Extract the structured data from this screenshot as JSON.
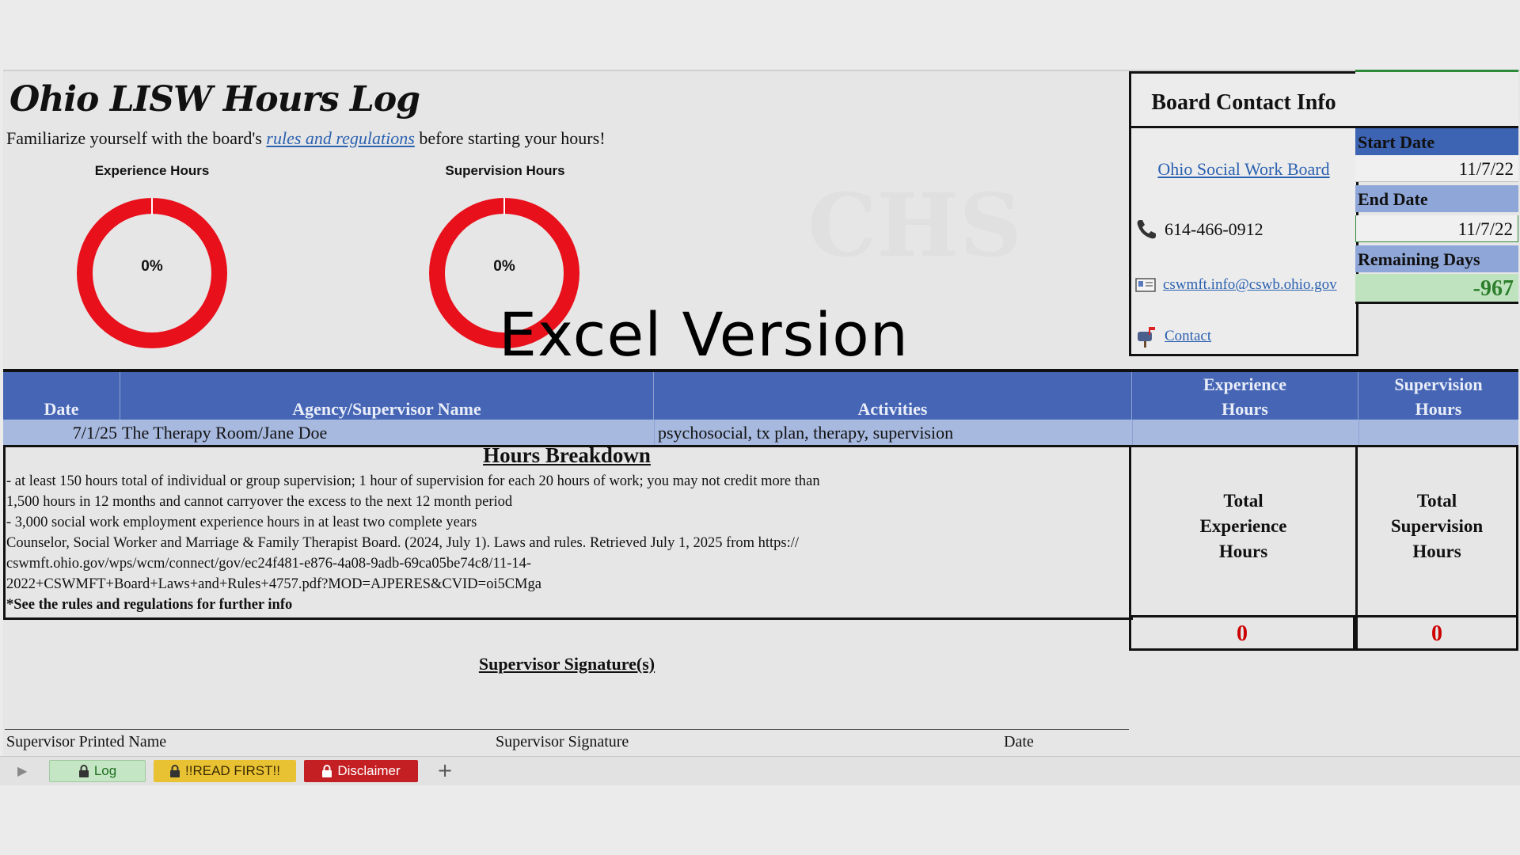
{
  "title": "Ohio LISW Hours Log",
  "subtitle": {
    "prefix": "Familiarize yourself with the board's ",
    "link": "rules and regulations",
    "suffix": " before starting your hours!"
  },
  "charts": {
    "experience": {
      "title": "Experience Hours",
      "label": "0%",
      "value": 0
    },
    "supervision": {
      "title": "Supervision Hours",
      "label": "0%",
      "value": 0
    }
  },
  "watermark": "Excel Version",
  "faint_logo": "CHS",
  "board": {
    "heading": "Board Contact Info",
    "link": "Ohio Social Work Board",
    "phone": "614-466-0912",
    "email": "cswmft.info@cswb.ohio.gov",
    "contact": "Contact"
  },
  "dates": {
    "start_label": "Start Date",
    "start_value": "11/7/22",
    "end_label": "End Date",
    "end_value": "11/7/22",
    "remaining_label": "Remaining Days",
    "remaining_value": "-967"
  },
  "table": {
    "headers": {
      "date": "Date",
      "agency": "Agency/Supervisor Name",
      "activities": "Activities",
      "exp_l1": "Experience",
      "exp_l2": "Hours",
      "sup_l1": "Supervision",
      "sup_l2": "Hours"
    },
    "rows": [
      {
        "date": "7/1/25",
        "agency": "The Therapy Room/Jane Doe",
        "activities": "psychosocial, tx plan, therapy, supervision",
        "exp": "",
        "sup": ""
      }
    ]
  },
  "breakdown": {
    "title": "Hours Breakdown",
    "lines": [
      "- at least 150 hours total of individual or group supervision; 1 hour of supervision for each 20 hours of work; you may not credit more than",
      "1,500 hours in 12 months and cannot carryover the excess to the next 12 month period",
      "- 3,000 social work employment experience hours in at least two complete years",
      "Counselor, Social Worker and Marriage & Family Therapist Board. (2024, July 1). Laws and rules. Retrieved July 1, 2025 from https://",
      "cswmft.ohio.gov/wps/wcm/connect/gov/ec24f481-e876-4a08-9adb-69ca05be74c8/11-14-",
      "2022+CSWMFT+Board+Laws+and+Rules+4757.pdf?MOD=AJPERES&CVID=oi5CMga"
    ],
    "note": "*See the rules and regulations for further info"
  },
  "totals": {
    "exp_l1": "Total",
    "exp_l2": "Experience",
    "exp_l3": "Hours",
    "exp_value": "0",
    "sup_l1": "Total",
    "sup_l2": "Supervision",
    "sup_l3": "Hours",
    "sup_value": "0"
  },
  "signature": {
    "title": "Supervisor Signature(s)",
    "printed_name": "Supervisor Printed Name",
    "signature": "Supervisor Signature",
    "date": "Date"
  },
  "tabs": [
    {
      "label": "Log",
      "icon": "lock-icon",
      "bg": "#c4e6c4",
      "fg": "#1f6f1f"
    },
    {
      "label": "!!READ FIRST!!",
      "icon": "lock-icon",
      "bg": "#e9c233",
      "fg": "#3a2a00"
    },
    {
      "label": "Disclaimer",
      "icon": "lock-icon",
      "bg": "#c41f23",
      "fg": "#ffffff"
    }
  ],
  "add_tab": "+",
  "colors": {
    "header_blue": "#4666b5",
    "row_blue": "#a7b9df",
    "donut_red": "#e8101a",
    "total_red": "#cc0000",
    "remain_green": "#bfe3bf"
  }
}
